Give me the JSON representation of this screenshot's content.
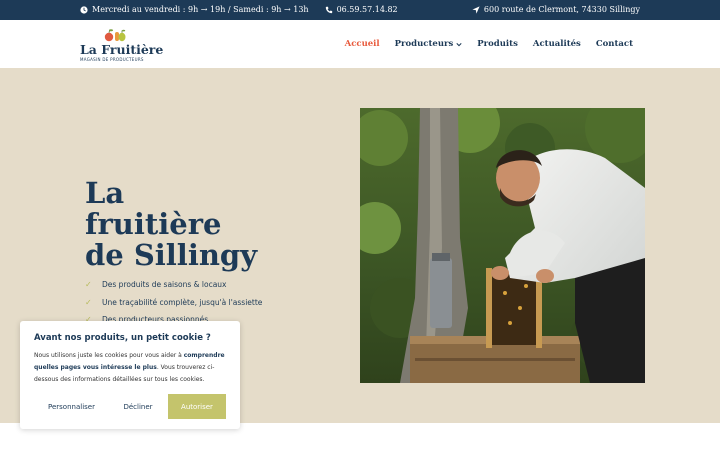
{
  "topbar": {
    "hours": "Mercredi au vendredi : 9h → 19h / Samedi : 9h → 13h",
    "phone": "06.59.57.14.82",
    "address": "600 route de Clermont, 74330 Sillingy"
  },
  "logo": {
    "title": "La Fruitière",
    "subtitle": "MAGASIN DE PRODUCTEURS"
  },
  "nav": {
    "items": [
      {
        "label": "Accueil",
        "active": true
      },
      {
        "label": "Producteurs",
        "dropdown": true
      },
      {
        "label": "Produits"
      },
      {
        "label": "Actualités"
      },
      {
        "label": "Contact"
      }
    ]
  },
  "hero": {
    "title_line1": "La",
    "title_line2": "fruitière",
    "title_line3": "de Sillingy",
    "features": [
      "Des produits de saisons & locaux",
      "Une traçabilité complète, jusqu'à l'assiette",
      "Des producteurs passionnés"
    ]
  },
  "cookie": {
    "title": "Avant nos produits, un petit cookie ?",
    "text_before": "Nous utilisons juste les cookies pour vous aider à ",
    "text_bold": "comprendre quelles pages vous intéresse le plus",
    "text_after": ". Vous trouverez ci-dessous des informations détaillées sur tous les cookies.",
    "personalize": "Personnaliser",
    "decline": "Décliner",
    "accept": "Autoriser"
  },
  "colors": {
    "navy": "#1d3a57",
    "accent": "#e85a3c",
    "hero_bg": "#e5dcc9",
    "check": "#b6ba5a",
    "accept_button": "#c4c46c"
  },
  "icons": [
    "clock-icon",
    "phone-icon",
    "location-arrow-icon",
    "chevron-down-icon",
    "check-icon"
  ]
}
